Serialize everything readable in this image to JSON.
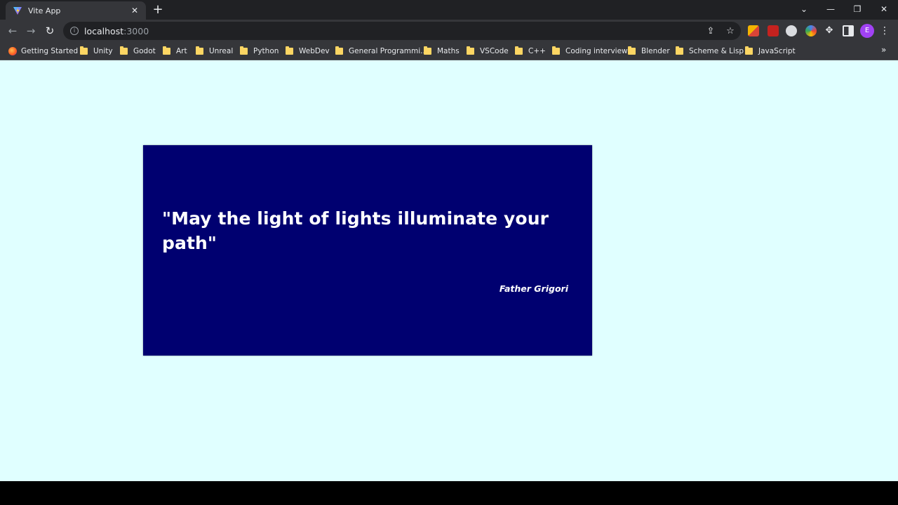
{
  "tab": {
    "title": "Vite App"
  },
  "address": {
    "host": "localhost",
    "port": ":3000"
  },
  "bookmarks": [
    "Getting Started",
    "Unity",
    "Godot",
    "Art",
    "Unreal",
    "Python",
    "WebDev",
    "General Programmi...",
    "Maths",
    "VSCode",
    "C++",
    "Coding interview",
    "Blender",
    "Scheme & Lisp",
    "JavaScript"
  ],
  "profile": {
    "initial": "E"
  },
  "page": {
    "background": "#e0ffff",
    "card_color": "#000070",
    "quote": "\"May the light of lights illuminate your path\"",
    "author": "Father Grigori"
  }
}
